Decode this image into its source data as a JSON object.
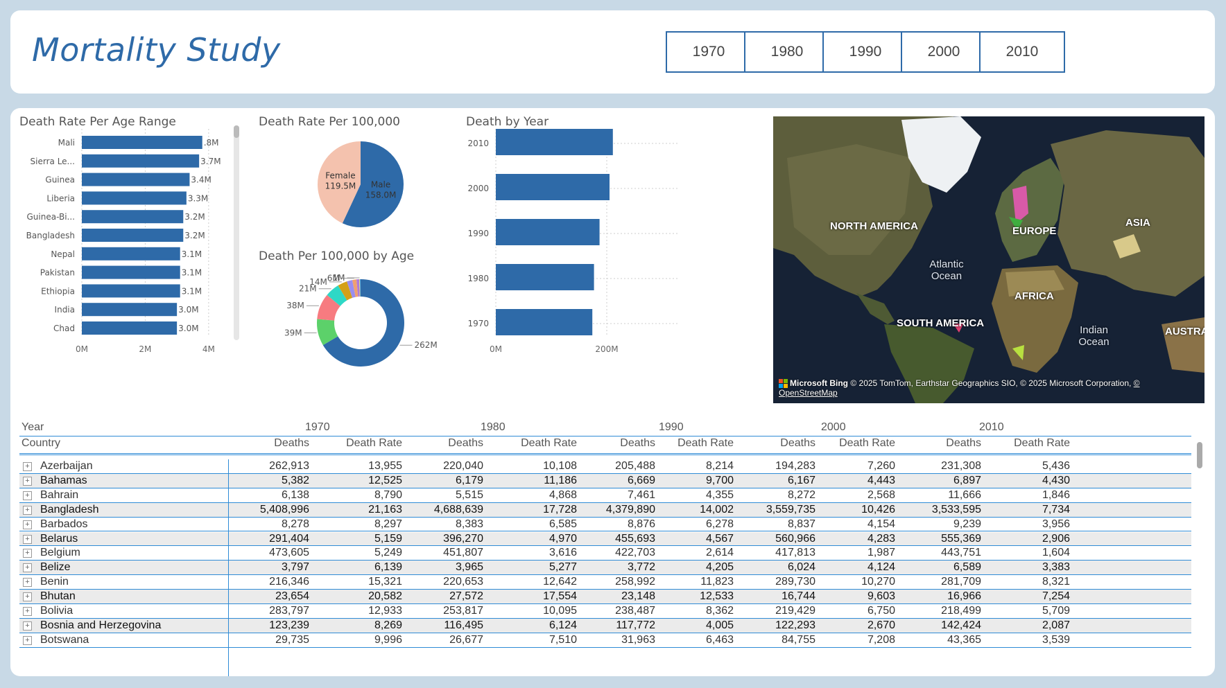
{
  "header": {
    "title": "Mortality Study",
    "year_buttons": [
      "1970",
      "1980",
      "1990",
      "2000",
      "2010"
    ]
  },
  "age_range_chart": {
    "title": "Death Rate Per Age Range",
    "countries": [
      "Mali",
      "Sierra Le...",
      "Guinea",
      "Liberia",
      "Guinea-Bi...",
      "Bangladesh",
      "Nepal",
      "Pakistan",
      "Ethiopia",
      "India",
      "Chad"
    ],
    "values": [
      3.8,
      3.7,
      3.4,
      3.3,
      3.2,
      3.2,
      3.1,
      3.1,
      3.1,
      3.0,
      3.0
    ],
    "labels": [
      ".8M",
      "3.7M",
      "3.4M",
      "3.3M",
      "3.2M",
      "3.2M",
      "3.1M",
      "3.1M",
      "3.1M",
      "3.0M",
      "3.0M"
    ],
    "x_ticks": [
      "0M",
      "2M",
      "4M"
    ],
    "xlim": [
      0,
      4.2
    ],
    "bar_color": "#2e6aa8"
  },
  "gender_pie": {
    "title": "Death Rate Per 100,000",
    "slices": [
      {
        "name": "Male",
        "value": 158.0,
        "label": "158.0M",
        "color": "#2e6aa8"
      },
      {
        "name": "Female",
        "value": 119.5,
        "label": "119.5M",
        "color": "#f4c2ae"
      }
    ]
  },
  "age_donut": {
    "title": "Death Per 100,000 by Age",
    "slices": [
      {
        "label": "262M",
        "value": 262,
        "color": "#2e6aa8"
      },
      {
        "label": "39M",
        "value": 39,
        "color": "#5cd16a"
      },
      {
        "label": "38M",
        "value": 38,
        "color": "#f77b80"
      },
      {
        "label": "21M",
        "value": 21,
        "color": "#2ed8c6"
      },
      {
        "label": "14M",
        "value": 14,
        "color": "#d4a018"
      },
      {
        "label": "",
        "value": 8,
        "color": "#9a8ef0"
      },
      {
        "label": "6M",
        "value": 6,
        "color": "#f0a070"
      },
      {
        "label": "",
        "value": 4,
        "color": "#b07ad8"
      },
      {
        "label": "1M",
        "value": 1,
        "color": "#e8e060"
      },
      {
        "label": "",
        "value": 1,
        "color": "#4aa0e0"
      }
    ]
  },
  "year_chart": {
    "title": "Death by Year",
    "categories": [
      "2010",
      "2000",
      "1990",
      "1980",
      "1970"
    ],
    "values": [
      211,
      205,
      187,
      177,
      174
    ],
    "x_ticks": [
      "0M",
      "200M"
    ],
    "xlim": [
      0,
      300
    ],
    "bar_color": "#2e6aa8"
  },
  "map": {
    "continents": [
      "NORTH AMERICA",
      "EUROPE",
      "ASIA",
      "AFRICA",
      "SOUTH AMERICA",
      "AUSTRA"
    ],
    "oceans": [
      "Atlantic\nOcean",
      "Indian\nOcean"
    ],
    "brand": "Microsoft Bing",
    "attribution": "© 2025 TomTom, Earthstar Geographics SIO, © 2025 Microsoft Corporation,",
    "attribution_link": "© OpenStreetMap"
  },
  "table": {
    "year_header": "Year",
    "country_header": "Country",
    "years": [
      "1970",
      "1980",
      "1990",
      "2000",
      "2010"
    ],
    "col_deaths": "Deaths",
    "col_rate": "Death Rate",
    "rows": [
      {
        "country": "Azerbaijan",
        "values": [
          "262,913",
          "13,955",
          "220,040",
          "10,108",
          "205,488",
          "8,214",
          "194,283",
          "7,260",
          "231,308",
          "5,436"
        ]
      },
      {
        "country": "Bahamas",
        "values": [
          "5,382",
          "12,525",
          "6,179",
          "11,186",
          "6,669",
          "9,700",
          "6,167",
          "4,443",
          "6,897",
          "4,430"
        ]
      },
      {
        "country": "Bahrain",
        "values": [
          "6,138",
          "8,790",
          "5,515",
          "4,868",
          "7,461",
          "4,355",
          "8,272",
          "2,568",
          "11,666",
          "1,846"
        ]
      },
      {
        "country": "Bangladesh",
        "values": [
          "5,408,996",
          "21,163",
          "4,688,639",
          "17,728",
          "4,379,890",
          "14,002",
          "3,559,735",
          "10,426",
          "3,533,595",
          "7,734"
        ]
      },
      {
        "country": "Barbados",
        "values": [
          "8,278",
          "8,297",
          "8,383",
          "6,585",
          "8,876",
          "6,278",
          "8,837",
          "4,154",
          "9,239",
          "3,956"
        ]
      },
      {
        "country": "Belarus",
        "values": [
          "291,404",
          "5,159",
          "396,270",
          "4,970",
          "455,693",
          "4,567",
          "560,966",
          "4,283",
          "555,369",
          "2,906"
        ]
      },
      {
        "country": "Belgium",
        "values": [
          "473,605",
          "5,249",
          "451,807",
          "3,616",
          "422,703",
          "2,614",
          "417,813",
          "1,987",
          "443,751",
          "1,604"
        ]
      },
      {
        "country": "Belize",
        "values": [
          "3,797",
          "6,139",
          "3,965",
          "5,277",
          "3,772",
          "4,205",
          "6,024",
          "4,124",
          "6,589",
          "3,383"
        ]
      },
      {
        "country": "Benin",
        "values": [
          "216,346",
          "15,321",
          "220,653",
          "12,642",
          "258,992",
          "11,823",
          "289,730",
          "10,270",
          "281,709",
          "8,321"
        ]
      },
      {
        "country": "Bhutan",
        "values": [
          "23,654",
          "20,582",
          "27,572",
          "17,554",
          "23,148",
          "12,533",
          "16,744",
          "9,603",
          "16,966",
          "7,254"
        ]
      },
      {
        "country": "Bolivia",
        "values": [
          "283,797",
          "12,933",
          "253,817",
          "10,095",
          "238,487",
          "8,362",
          "219,429",
          "6,750",
          "218,499",
          "5,709"
        ]
      },
      {
        "country": "Bosnia and Herzegovina",
        "values": [
          "123,239",
          "8,269",
          "116,495",
          "6,124",
          "117,772",
          "4,005",
          "122,293",
          "2,670",
          "142,424",
          "2,087"
        ]
      },
      {
        "country": "Botswana",
        "values": [
          "29,735",
          "9,996",
          "26,677",
          "7,510",
          "31,963",
          "6,463",
          "84,755",
          "7,208",
          "43,365",
          "3,539"
        ]
      }
    ]
  }
}
